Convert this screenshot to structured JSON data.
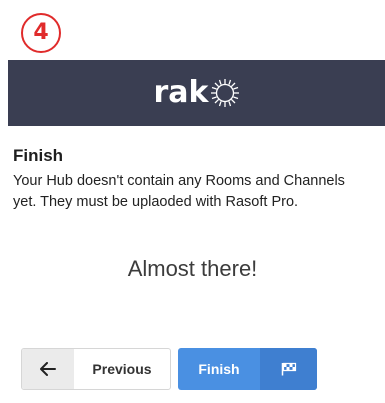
{
  "step_badge": {
    "number": "4"
  },
  "header": {
    "logo_text": "rak"
  },
  "content": {
    "title": "Finish",
    "description": "Your Hub doesn't contain any Rooms and Channels yet. They must be uplaoded with Rasoft Pro."
  },
  "status_message": "Almost there!",
  "buttons": {
    "previous_label": "Previous",
    "finish_label": "Finish"
  },
  "icons": {
    "previous_icon": "arrow-left-icon",
    "finish_icon": "flag-checkered-icon",
    "logo_mark": "starburst-o-icon"
  },
  "colors": {
    "header_bg": "#3a3e52",
    "badge_red": "#e02b2b",
    "finish_blue": "#4a90e2"
  }
}
